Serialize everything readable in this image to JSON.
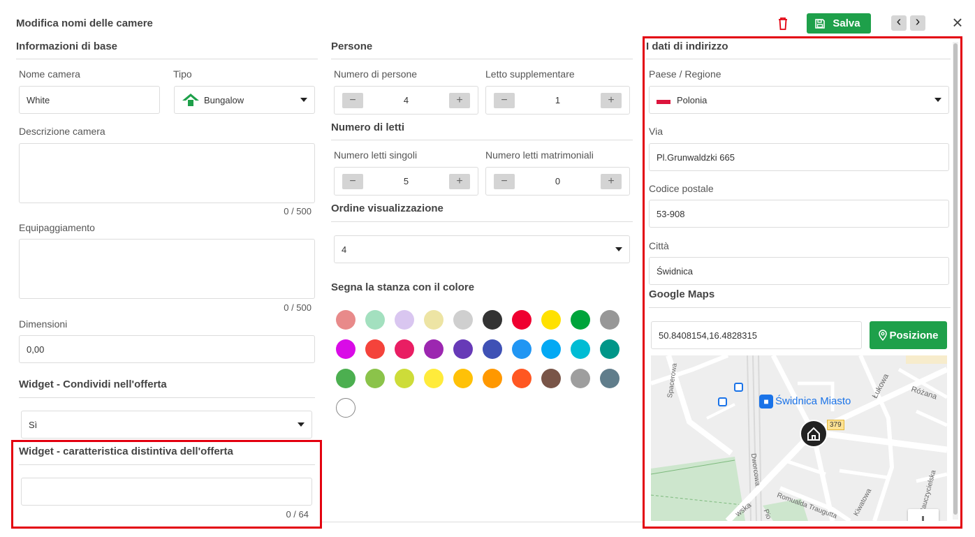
{
  "header": {
    "title": "Modifica nomi delle camere",
    "save_label": "Salva",
    "prev_label": "‹",
    "next_label": "›",
    "close_label": "×"
  },
  "basic": {
    "title": "Informazioni di base",
    "room_name_label": "Nome camera",
    "room_name_value": "White",
    "type_label": "Tipo",
    "type_value": "Bungalow",
    "description_label": "Descrizione camera",
    "description_counter": "0 / 500",
    "equipment_label": "Equipaggiamento",
    "equipment_counter": "0 / 500",
    "dimensions_label": "Dimensioni",
    "dimensions_value": "0,00"
  },
  "widget_share": {
    "title": "Widget - Condividi nell'offerta",
    "value": "Sì"
  },
  "widget_feature": {
    "title": "Widget - caratteristica distintiva dell'offerta",
    "counter": "0 / 64"
  },
  "persons": {
    "title": "Persone",
    "count_label": "Numero di persone",
    "count_value": "4",
    "extra_bed_label": "Letto supplementare",
    "extra_bed_value": "1"
  },
  "beds": {
    "title": "Numero di letti",
    "single_label": "Numero letti singoli",
    "single_value": "5",
    "double_label": "Numero letti matrimoniali",
    "double_value": "0"
  },
  "display_order": {
    "title": "Ordine visualizzazione",
    "value": "4"
  },
  "color_marker": {
    "title": "Segna la stanza con il colore",
    "colors": [
      "#e88a8a",
      "#a3e0bf",
      "#d9c6f0",
      "#ede4a4",
      "#cfcfcf",
      "#333333",
      "#ef0030",
      "#ffe100",
      "#00a43b",
      "#979797",
      "#d90be7",
      "#f4433b",
      "#e91e63",
      "#9c27b0",
      "#673ab7",
      "#3f51b5",
      "#2196f3",
      "#03a9f4",
      "#00bcd4",
      "#009688",
      "#4caf50",
      "#8bc34a",
      "#cddc39",
      "#ffeb3b",
      "#ffc107",
      "#ff9800",
      "#ff5722",
      "#795548",
      "#9e9e9e",
      "#607d8b",
      "#ffffff"
    ]
  },
  "address": {
    "title": "I dati di indirizzo",
    "country_label": "Paese / Regione",
    "country_value": "Polonia",
    "street_label": "Via",
    "street_value": "Pl.Grunwaldzki 665",
    "postal_label": "Codice postale",
    "postal_value": "53-908",
    "city_label": "Città",
    "city_value": "Świdnica"
  },
  "maps": {
    "title": "Google Maps",
    "coords_value": "50.8408154,16.4828315",
    "position_button": "Posizione",
    "streets": [
      "Spacerowa",
      "Łukowa",
      "Różana",
      "Dworcowa",
      "Romualda Traugutta",
      "Kiwatowa",
      "Nauczycielska",
      "wska",
      "Pio"
    ],
    "station_label": "Świdnica Miasto",
    "road_number": "379"
  },
  "accent": {
    "green": "#1ea04a",
    "red": "#e3000f"
  }
}
